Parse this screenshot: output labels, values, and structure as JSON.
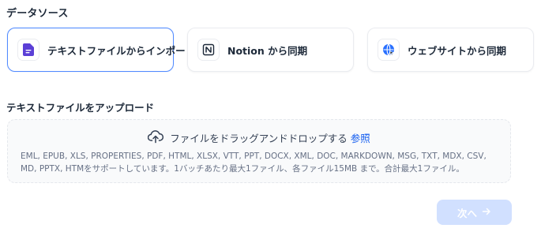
{
  "data_source": {
    "label": "データソース",
    "options": [
      {
        "label": "テキストファイルからインポート",
        "icon": "file-text-icon",
        "selected": true
      },
      {
        "label": "Notion から同期",
        "icon": "notion-icon",
        "selected": false
      },
      {
        "label": "ウェブサイトから同期",
        "icon": "website-globe-icon",
        "selected": false
      }
    ]
  },
  "upload": {
    "label": "テキストファイルをアップロード",
    "drop_text": "ファイルをドラッグアンドドロップする",
    "browse_text": "参照",
    "formats_line1": "EML, EPUB, XLS, PROPERTIES, PDF, HTML, XLSX, VTT, PPT, DOCX, XML, DOC, MARKDOWN, MSG, TXT, MDX, CSV,",
    "formats_line2": "MD, PPTX, HTMをサポートしています。1バッチあたり最大1ファイル、各ファイル15MB まで。合計最大1ファイル。"
  },
  "actions": {
    "next_label": "次へ",
    "next_icon": "arrow-right-icon",
    "next_enabled": false
  },
  "colors": {
    "accent": "#155eef",
    "selected_border": "#528bff",
    "disabled_button": "#d1e0ff"
  }
}
